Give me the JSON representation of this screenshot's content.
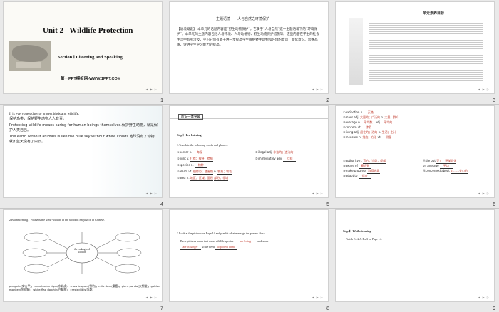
{
  "slides": {
    "s1": {
      "number": "1",
      "unit": "Unit 2",
      "title": "Wildlife Protection",
      "section": "Section Ⅰ  Listening and Speaking",
      "watermark": "第一PPT模板网-WWW.1PPT.COM"
    },
    "s2": {
      "number": "2",
      "heading": "主题语境——人与自然之环境保护",
      "body": "【语境概说】  本单元的话题内容是“野生动物保护”，它属于“人与自然”这一主题语境下的“环境保护”。本单元的主题内容包括人与环境、人与动植物、野生动物保护措施等。这些内容在学生的社会生活中有所涉及，学习它们有助于进一步提高学生保护野生动物和环境的意识，文化意识、思维品质、促进学生学习能力的提高。"
    },
    "s3": {
      "number": "3",
      "heading": "单元素养目标"
    },
    "s4": {
      "number": "4",
      "p1": "It is everyone's duty to protect birds and wildlife.",
      "p1zh": "保护鸟类，保护野生动物人人有责。",
      "p2": "Protecting wildlife means caring for human beings themselves.保护野生动物，就是保护人类自己。",
      "p3": "The earth without animals is like the blue sky without white clouds.地球没有了动物，就如蓝天没有了白云。"
    },
    "s5": {
      "number": "5",
      "badge": "听说一体突破",
      "step": "Step Ⅰ",
      "step_title": "Pre-listening",
      "instruction": "1.Translate the following words and phrases.",
      "items": [
        {
          "n": "①poster n.",
          "a": "海报"
        },
        {
          "n": "②hunt v.",
          "a": "打猎；搜寻；猎捕"
        },
        {
          "n": "③species n.",
          "a": "物种"
        },
        {
          "n": "④alarm  vt.",
          "a": "使惊恐；使害怕"
        },
        {
          "n": "⑤area  n.",
          "a": "地区；区域；面积"
        }
      ],
      "items_right": [
        {
          "n": "⑥illegal adj.",
          "a": "非法的；违法的"
        },
        {
          "n": "⑦immediately adv.",
          "a": "立刻"
        },
        {
          "n": "n.",
          "a": "警报；警告"
        },
        {
          "n": "",
          "a": "部分；领域"
        }
      ]
    },
    "s6": {
      "number": "6",
      "items": [
        {
          "n": "①extinction n.",
          "a": "灭绝"
        },
        {
          "n": "②mass  adj.",
          "a": "大量的；广泛的"
        },
        {
          "n": "③average  n.",
          "a": "平均数"
        },
        {
          "n": "④concern vt.",
          "a": "涉及"
        },
        {
          "n": "⑤living  adj.",
          "a": "居住的；活的"
        },
        {
          "n": "⑥measure  n.",
          "a": "措施；方法"
        },
        {
          "n": "⑦authority n.",
          "a": "官方；当局；权威"
        },
        {
          "n": "⑧aware of",
          "a": "意识到"
        },
        {
          "n": "⑨make progress",
          "a": "取得进展"
        },
        {
          "n": "⑩adapt to",
          "a": "适应"
        }
      ],
      "items_right": [
        {
          "n": "n.",
          "a": "大量；群众"
        },
        {
          "n": "adj.",
          "a": "平均的"
        },
        {
          "n": "n.",
          "a": "生活；生计"
        },
        {
          "n": "vt.",
          "a": "测量"
        },
        {
          "n": "⑪die out",
          "a": "灭亡；逐渐消失"
        },
        {
          "n": "on average",
          "a": "平均"
        },
        {
          "n": "⑫concerned about",
          "a": "对……关心的"
        }
      ]
    },
    "s7": {
      "number": "7",
      "question": "2.Brainstorming：Please name some wildlife in the world in English or in Chinese.",
      "center": "the endangered wildlife",
      "answer": "pangolin(穿山甲)，manchurian tiger(东北虎)，snow leopard(雪豹)，milu deer(麋鹿)，giant panda(大熊猫)，golden monkey(金丝猴)，white-flag dolphin(白鳍豚)，crested ibis(朱鹮)"
    },
    "s8": {
      "number": "8",
      "question": "3.Look at the pictures on Page 14 and predict what message the posters share.",
      "line1": "These pictures mean that some wildlife species",
      "blank1": "are losing",
      "line1b": "and some",
      "blank2": "are in danger",
      "line2": "so we need",
      "blank3": "to protect them",
      "end": "."
    },
    "s9": {
      "number": "9",
      "step": "Step Ⅱ",
      "step_title": "While-listening",
      "instruction": "Finish Ex.2 & Ex.3 on Page 14."
    }
  },
  "colors": {
    "accent_red": "#c0392b",
    "slide_bg": "#ffffff",
    "page_bg": "#e9e9e9"
  }
}
